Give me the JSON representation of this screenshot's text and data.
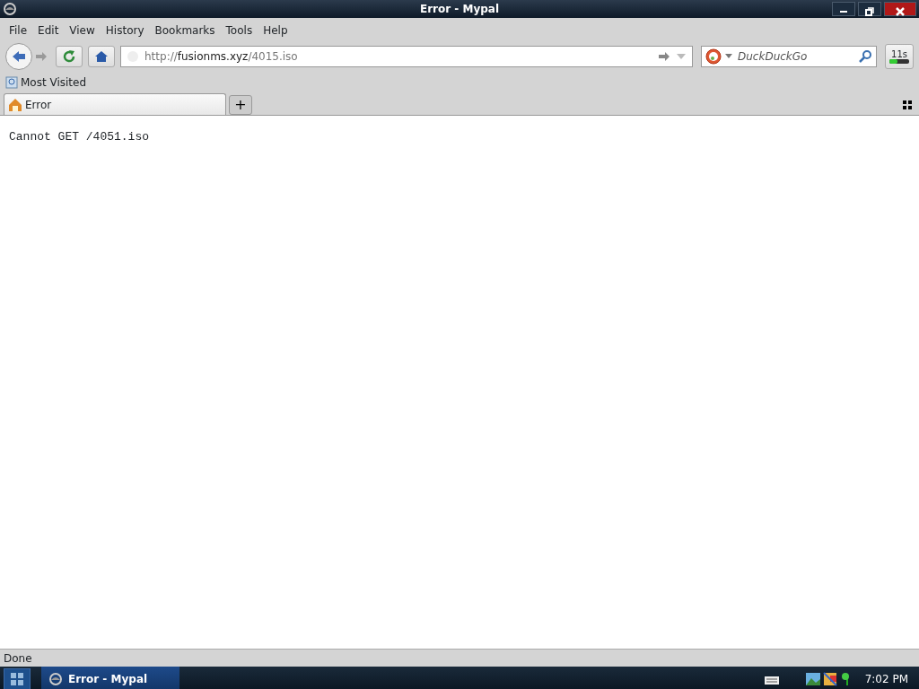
{
  "window": {
    "title": "Error - Mypal"
  },
  "menu": [
    "File",
    "Edit",
    "View",
    "History",
    "Bookmarks",
    "Tools",
    "Help"
  ],
  "address": {
    "scheme": "http://",
    "host": "fusionms.xyz",
    "path": "/4015.iso"
  },
  "search": {
    "placeholder": "DuckDuckGo"
  },
  "timer": {
    "label": "11s",
    "level": 0.4
  },
  "bookmarks": [
    "Most Visited"
  ],
  "tabs": [
    {
      "label": "Error",
      "selected": true
    }
  ],
  "new_tab": "+",
  "content": {
    "text": "Cannot GET /4051.iso"
  },
  "status_bar": "Done",
  "taskbar": {
    "tasks": [
      {
        "label": "Error - Mypal",
        "selected": true
      }
    ],
    "clock": "7:02 PM"
  }
}
